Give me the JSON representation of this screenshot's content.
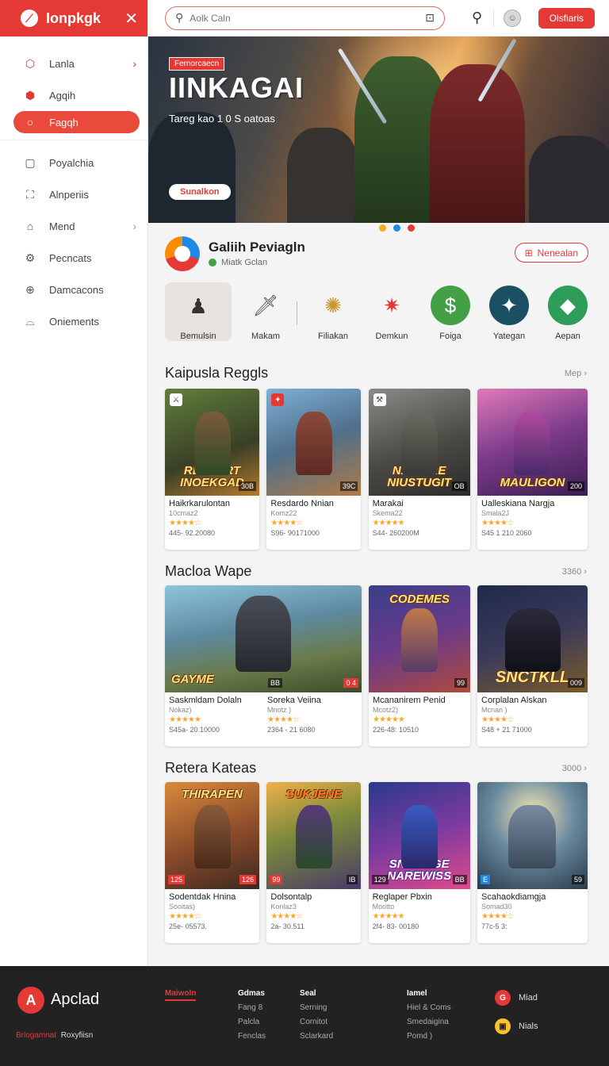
{
  "sidebar": {
    "brand": "Ionpkgk",
    "items": [
      {
        "label": "Lanla",
        "icon": "shield-icon"
      },
      {
        "label": "Agqih",
        "icon": "tag-icon"
      },
      {
        "label": "Fagqh",
        "icon": "search-icon"
      },
      {
        "label": "Poyalchia",
        "icon": "square-icon"
      },
      {
        "label": "Alnperiis",
        "icon": "bookmark-icon"
      },
      {
        "label": "Mend",
        "icon": "home-icon"
      },
      {
        "label": "Pecncats",
        "icon": "gear-icon"
      },
      {
        "label": "Damcacons",
        "icon": "plus-circle-icon"
      },
      {
        "label": "Oniements",
        "icon": "controller-icon"
      }
    ]
  },
  "topbar": {
    "search_placeholder": "Aolk Caln",
    "button_label": "Olsfiaris"
  },
  "hero": {
    "tag": "Fernorcaecn",
    "title": "IINKAGAI",
    "subtitle": "Tareg kao 1 0 S oatoas",
    "cta": "Sunalkon",
    "dot_colors": [
      "#f9a825",
      "#1e88e5",
      "#e53935"
    ]
  },
  "game": {
    "title": "Galiih Peviagln",
    "status": "Miatk Gclan",
    "button": "Nenealan"
  },
  "categories": [
    {
      "label": "Bemulsin",
      "icon": "character-icon",
      "bg": "#e7e2de",
      "color": "#333"
    },
    {
      "label": "Makam",
      "icon": "sword-icon",
      "bg": "transparent",
      "color": "#555"
    },
    {
      "label": "Filiakan",
      "icon": "badge-icon",
      "bg": "transparent",
      "color": "#c9962d"
    },
    {
      "label": "Demkun",
      "icon": "star-burst-icon",
      "bg": "transparent",
      "color": "#e53935"
    },
    {
      "label": "Foiga",
      "icon": "dollar-icon",
      "bg": "#43a047",
      "color": "#fff"
    },
    {
      "label": "Yategan",
      "icon": "compass-icon",
      "bg": "#1b4f63",
      "color": "#fff"
    },
    {
      "label": "Aepan",
      "icon": "chat-icon",
      "bg": "#2e9d5a",
      "color": "#fff"
    }
  ],
  "section1": {
    "title": "Kaipusla Reggls",
    "more": "Mep",
    "cards": [
      {
        "name": "Haikrkarulontan",
        "meta": "10cmaz2",
        "stars": "★★★★☆",
        "stat": "445- 92.20080",
        "logo": "RESTORT INOEKGAD",
        "badge": "30B",
        "corner": "⚔"
      },
      {
        "name": "Resdardo Nnian",
        "meta": "Komz22",
        "stars": "★★★★☆",
        "stat": "S96- 90171000",
        "logo": "",
        "badge": "39C",
        "corner": "✦"
      },
      {
        "name": "Marakai",
        "meta": "Skema22",
        "stars": "★★★★★",
        "stat": "S44- 260200M",
        "logo": "NAEDIRE NIUSTUGIT",
        "badge": "OB",
        "corner": "⚒"
      },
      {
        "name": "Ualleskiana Nargja",
        "meta": "Smala2J",
        "stars": "★★★★☆",
        "stat": "S45 1 210 2060",
        "logo": "MAULIGON",
        "badge": "200",
        "corner": ""
      }
    ]
  },
  "section2": {
    "title": "Macloa Wape",
    "more": "3360",
    "cards": [
      {
        "name": "Saskmldam Dolaln",
        "meta": "Nokaz)",
        "stars": "★★★★★",
        "stat": "S45a- 20.10000",
        "logo": "GAYME",
        "badge": "BB"
      },
      {
        "name": "Soreka Veiina",
        "meta": "Mnotz )",
        "stars": "★★★★☆",
        "stat": "2364 - 21 6080",
        "logo": "",
        "badge": "0 4"
      },
      {
        "name": "Mcananirem Penid",
        "meta": "Mcotz2)",
        "stars": "★★★★★",
        "stat": "226-48: 10510",
        "logo": "CODEMES",
        "badge": "99"
      },
      {
        "name": "Corplalan Alskan",
        "meta": "Mcnan )",
        "stars": "★★★★☆",
        "stat": "S48 + 21 71000",
        "logo": "SNCTKLL",
        "badge": "009"
      }
    ]
  },
  "section3": {
    "title": "Retera Kateas",
    "more": "3000",
    "cards": [
      {
        "name": "Sodentdak Hnina",
        "meta": "Sooitas)",
        "stars": "★★★★☆",
        "stat": "25e- 05573.",
        "logo": "THIRAPEN",
        "badge": "126",
        "badgeL": "125"
      },
      {
        "name": "Dolsontalp",
        "meta": "Konlaz3",
        "stars": "★★★★☆",
        "stat": "2a- 30.511",
        "logo": "SUKJENE",
        "badge": "IB",
        "badgeL": "99"
      },
      {
        "name": "Reglaper Pbxin",
        "meta": "Mootto",
        "stars": "★★★★★",
        "stat": "2f4- 83- 00180",
        "logo": "SNUGNGE NAREWISS",
        "badge": "BB",
        "badgeL": "129"
      },
      {
        "name": "Scahaokdiamgja",
        "meta": "Somad30",
        "stars": "★★★★☆",
        "stat": "77c-5 3:",
        "logo": "",
        "badge": "59",
        "badgeL": "E"
      }
    ]
  },
  "footer": {
    "brand": "Apclad",
    "tag_red": "Brlogamnat",
    "tag_white": "Roxyfiisn",
    "cols": [
      {
        "head": "Maiwoln",
        "red": true,
        "items": []
      },
      {
        "head": "Gdmas",
        "items": [
          "Fang  8",
          "Palcla",
          "Fenclas"
        ]
      },
      {
        "head": "Seal",
        "items": [
          "Serning",
          "Cornitot",
          "Sclarkard"
        ]
      },
      {
        "head": "Iamel",
        "items": [
          "Hiel & Coms",
          "Smedaigina",
          "Pomd )"
        ]
      }
    ],
    "social": [
      {
        "label": "Miad",
        "icon": "g-icon",
        "color": "#e53935",
        "glyph": "G"
      },
      {
        "label": "Nials",
        "icon": "mail-icon",
        "color": "#fbc02d",
        "glyph": "▣"
      }
    ]
  }
}
